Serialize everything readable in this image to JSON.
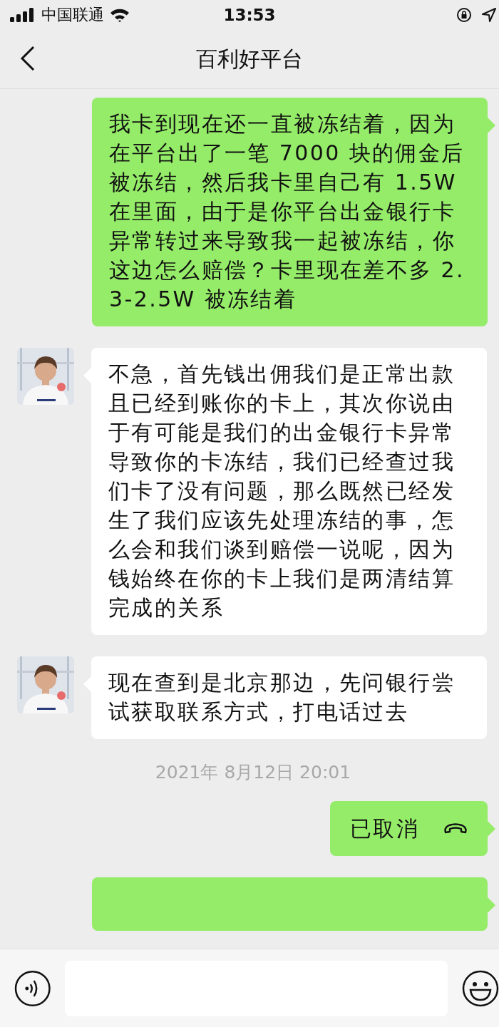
{
  "status_bar": {
    "carrier": "中国联通",
    "time": "13:53"
  },
  "nav": {
    "title": "百利好平台"
  },
  "messages": [
    {
      "kind": "sent",
      "text": "我卡到现在还一直被冻结着，因为在平台出了一笔 7000 块的佣金后被冻结，然后我卡里自己有 1.5W 在里面，由于是你平台出金银行卡异常转过来导致我一起被冻结，你这边怎么赔偿？卡里现在差不多 2.3-2.5W 被冻结着"
    },
    {
      "kind": "received",
      "text": "不急，首先钱出佣我们是正常出款且已经到账你的卡上，其次你说由于有可能是我们的出金银行卡异常导致你的卡冻结，我们已经查过我们卡了没有问题，那么既然已经发生了我们应该先处理冻结的事，怎么会和我们谈到赔偿一说呢，因为钱始终在你的卡上我们是两清结算完成的关系"
    },
    {
      "kind": "received",
      "text": "现在查到是北京那边，先问银行尝试获取联系方式，打电话过去"
    },
    {
      "kind": "time",
      "text": "2021年 8月12日 20:01"
    },
    {
      "kind": "call",
      "text": "已取消"
    },
    {
      "kind": "sent"
    }
  ]
}
